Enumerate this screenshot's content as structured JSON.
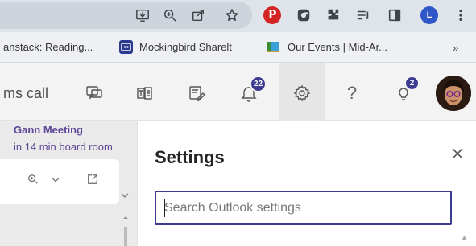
{
  "browser": {
    "bookmarks": [
      {
        "label": "anstack: Reading...",
        "icon": "bookmark-page-icon"
      },
      {
        "label": "Mockingbird Sharelt",
        "icon": "mockingbird-icon"
      },
      {
        "label": "Our Events | Mid-Ar...",
        "icon": "events-flag-icon"
      }
    ],
    "more_label": "»",
    "profile_initial": "L",
    "toolbar_icons": [
      "install-app-icon",
      "zoom-icon",
      "share-icon",
      "star-icon",
      "pinterest-icon",
      "extension-icon",
      "puzzle-icon",
      "reading-list-icon",
      "side-panel-icon",
      "profile-icon",
      "menu-dots-icon"
    ]
  },
  "appbar": {
    "meeting_text": "ms call",
    "notifications_count": "22",
    "tips_count": "2",
    "help_label": "?",
    "icons": [
      "chat-icon",
      "teams-icon",
      "tasks-icon",
      "bell-icon",
      "gear-icon",
      "help-icon",
      "lightbulb-icon",
      "avatar"
    ]
  },
  "left_pane": {
    "reminder_title": "Gann Meeting",
    "reminder_sub": "in 14 min board room"
  },
  "settings": {
    "title": "Settings",
    "close_label": "✕",
    "search_placeholder": "Search Outlook settings",
    "search_value": ""
  },
  "colors": {
    "accent": "#3b3b8f",
    "reminder_text": "#5c4696",
    "pinterest": "#d32424",
    "profile": "#2f57c7"
  }
}
